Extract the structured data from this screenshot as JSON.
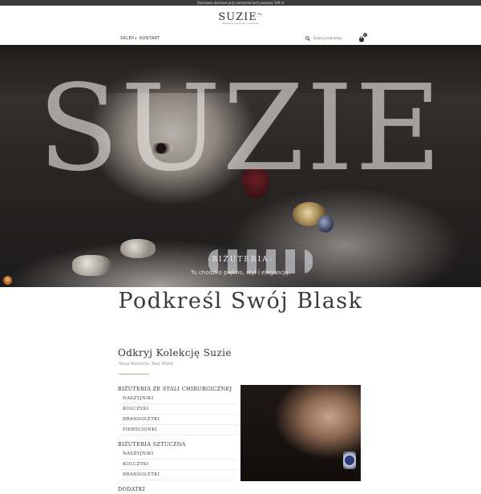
{
  "topbar": {
    "text": "Darmowa dostawa przy zamówieniach powyżej 149 zł"
  },
  "header": {
    "logo_text": "SUZIE",
    "logo_tagline": "Biżuteria tworzona z miłością"
  },
  "nav": {
    "items": [
      {
        "label": "SKLEP",
        "has_dropdown": true
      },
      {
        "label": "KONTAKT",
        "has_dropdown": false
      }
    ],
    "search_placeholder": "Szukaj produktów",
    "cart_count": "0"
  },
  "hero": {
    "title": "SUZIE",
    "subtitle": "-BIŻUTERIA-",
    "description": "Tu chodzi o piękno, styl i elegancję."
  },
  "tagline": "Podkreśl Swój Blask",
  "collection": {
    "title": "Odkryj Kolekcję Suzie",
    "subtitle": "Twoja Biżuteria, Twój Wybór",
    "categories": [
      {
        "label": "BIŻUTERIA ZE STALI CHIRURGICZNEJ",
        "sub": [
          "NASZYJNIKI",
          "KOLCZYKI",
          "BRANSOLETKI",
          "PIERŚCIONKI"
        ]
      },
      {
        "label": "BIŻUTERIA SZTUCZNA",
        "sub": [
          "NASZYJNIKI",
          "KOLCZYKI",
          "BRANSOLETKI"
        ]
      },
      {
        "label": "DODATKI",
        "sub": []
      }
    ]
  },
  "colors": {
    "accent": "#c9a876",
    "topbar": "#3b3b3b",
    "float_button": "#c06a1f"
  }
}
